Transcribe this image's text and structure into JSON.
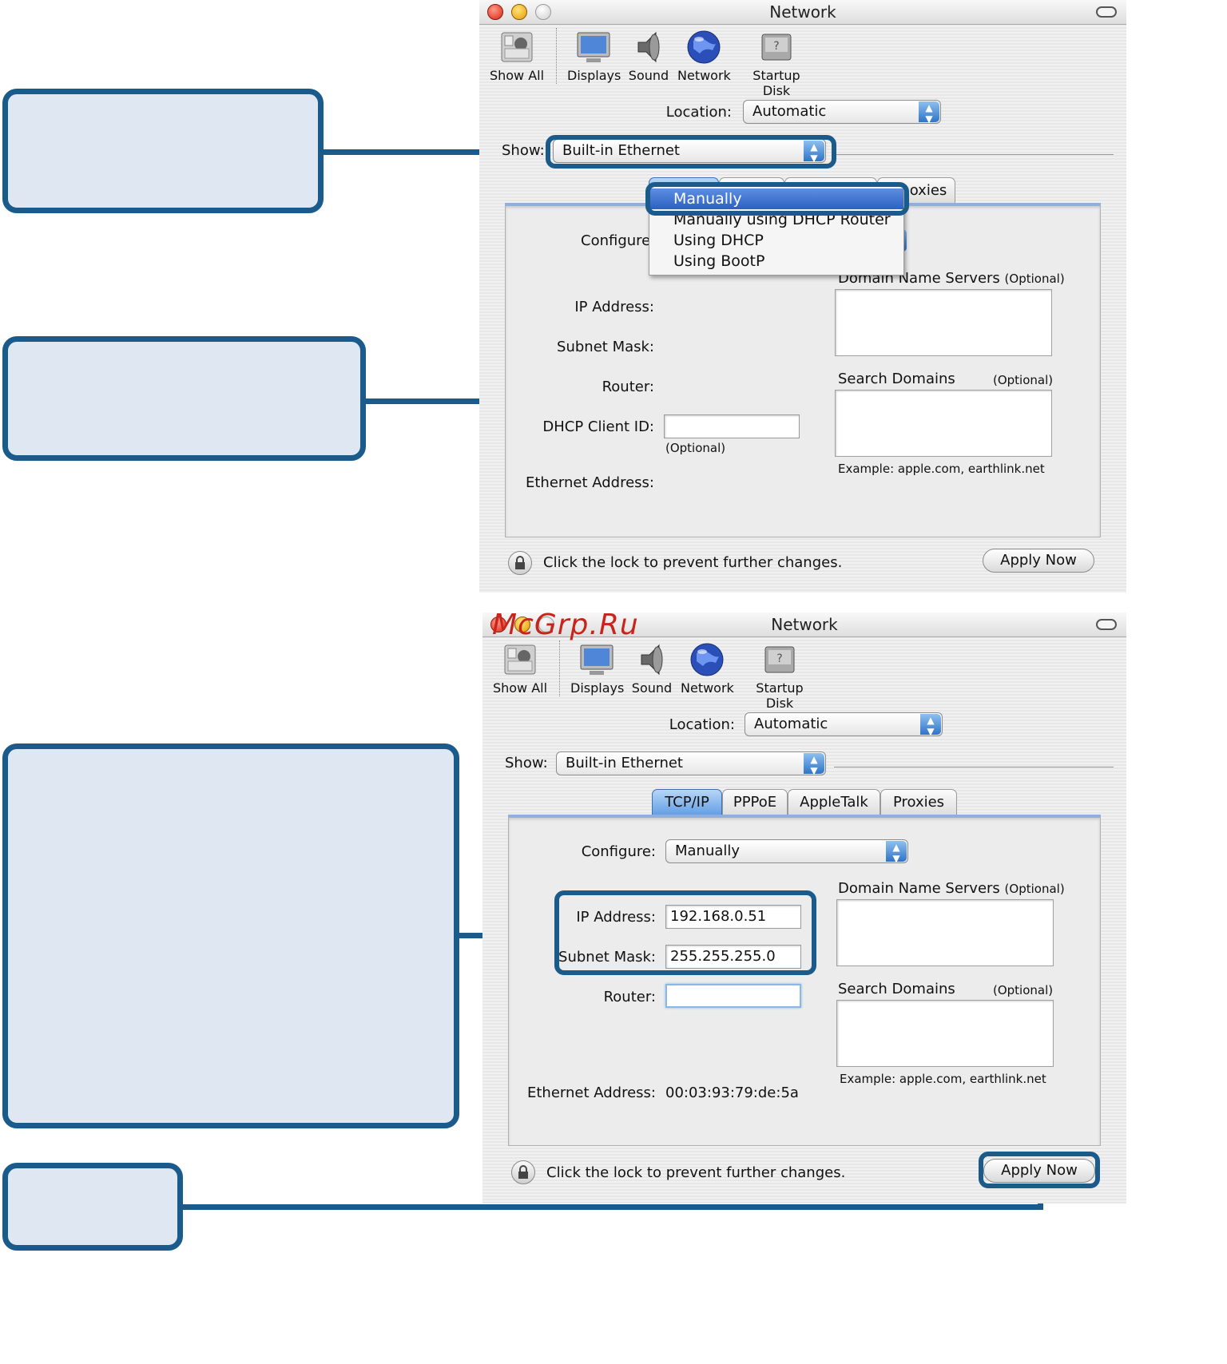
{
  "watermark": "McGrp.Ru",
  "window": {
    "title": "Network",
    "toolbar": [
      {
        "label": "Show All",
        "icon": "show-all-icon"
      },
      {
        "label": "Displays",
        "icon": "displays-icon"
      },
      {
        "label": "Sound",
        "icon": "sound-icon"
      },
      {
        "label": "Network",
        "icon": "network-globe-icon"
      },
      {
        "label": "Startup Disk",
        "icon": "startup-disk-icon"
      }
    ],
    "location_label": "Location:",
    "location_value": "Automatic",
    "show_label": "Show:",
    "show_value": "Built-in Ethernet",
    "tabs": [
      "TCP/IP",
      "PPPoE",
      "AppleTalk",
      "Proxies"
    ],
    "configure_label": "Configure:",
    "dns_label": "Domain Name Servers",
    "optional": "(Optional)",
    "search_domains_label": "Search Domains",
    "example": "Example: apple.com, earthlink.net",
    "ip_label": "IP Address:",
    "subnet_label": "Subnet Mask:",
    "router_label": "Router:",
    "dhcp_label": "DHCP Client ID:",
    "ethernet_label": "Ethernet Address:",
    "lock_text": "Click the lock to prevent further changes.",
    "apply_label": "Apply Now"
  },
  "screen1": {
    "configure_menu": [
      "Manually",
      "Manually using DHCP Router",
      "Using DHCP",
      "Using BootP"
    ],
    "selected_item": "Manually",
    "tab_visible_tail": "oxies"
  },
  "screen2": {
    "configure_value": "Manually",
    "ip_value": "192.168.0.51",
    "subnet_value": "255.255.255.0",
    "router_value": "",
    "ethernet_value": "00:03:93:79:de:5a"
  },
  "colors": {
    "callout_fill": "#dfe8f2",
    "callout_border": "#1b5b8c",
    "selection": "#2c5fc4",
    "aqua_blue": "#5e9ce4"
  }
}
